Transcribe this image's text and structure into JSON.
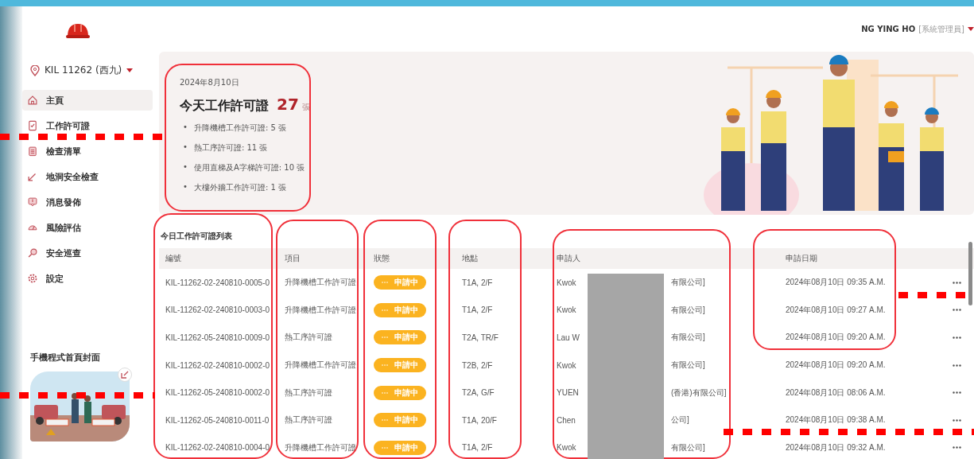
{
  "user": {
    "name": "NG YING HO",
    "role": "[系統管理員]"
  },
  "site": {
    "label": "KIL 11262 (西九)"
  },
  "sidebar": {
    "items": [
      {
        "label": "主頁",
        "selected": true
      },
      {
        "label": "工作許可證",
        "selected": false
      },
      {
        "label": "檢查清單",
        "selected": false
      },
      {
        "label": "地洞安全檢查",
        "selected": false
      },
      {
        "label": "消息發佈",
        "selected": false
      },
      {
        "label": "風險評估",
        "selected": false
      },
      {
        "label": "安全巡查",
        "selected": false
      },
      {
        "label": "設定",
        "selected": false
      }
    ],
    "cover_title": "手機程式首頁封面"
  },
  "summary": {
    "date": "2024年8月10日",
    "title": "今天工作許可證",
    "count": "27",
    "unit": "張",
    "bullet": "•",
    "items": [
      "升降機槽工作許可證: 5 張",
      "熱工序許可證: 11 張",
      "使用直梯及A字梯許可證: 10 張",
      "大樓外牆工作許可證: 1 張"
    ]
  },
  "table": {
    "title": "今日工作許可證列表",
    "columns": [
      "編號",
      "項目",
      "狀態",
      "地點",
      "申請人",
      "申請日期"
    ],
    "rows": [
      {
        "id": "KIL-11262-02-240810-0005-0",
        "item": "升降機槽工作許可證",
        "status": "申請中",
        "location": "T1A, 2/F",
        "applicant_start": "Kwok",
        "applicant_end": "有限公司]",
        "date": "2024年08月10日 09:35 A.M."
      },
      {
        "id": "KIL-11262-02-240810-0003-0",
        "item": "升降機槽工作許可證",
        "status": "申請中",
        "location": "T1A, 2/F",
        "applicant_start": "Kwok",
        "applicant_end": "有限公司]",
        "date": "2024年08月10日 09:27 A.M."
      },
      {
        "id": "KIL-11262-05-240810-0009-0",
        "item": "熱工序許可證",
        "status": "申請中",
        "location": "T2A, TR/F",
        "applicant_start": "Lau W",
        "applicant_end": "有限公司]",
        "date": "2024年08月10日 09:20 A.M."
      },
      {
        "id": "KIL-11262-02-240810-0002-0",
        "item": "升降機槽工作許可證",
        "status": "申請中",
        "location": "T2B, 2/F",
        "applicant_start": "Kwok",
        "applicant_end": "有限公司]",
        "date": "2024年08月10日 09:20 A.M."
      },
      {
        "id": "KIL-11262-05-240810-0002-0",
        "item": "熱工序許可證",
        "status": "申請中",
        "location": "T2A, G/F",
        "applicant_start": "YUEN",
        "applicant_end": "(香港)有限公司]",
        "date": "2024年08月10日 08:06 A.M."
      },
      {
        "id": "KIL-11262-05-240810-0011-0",
        "item": "熱工序許可證",
        "status": "申請中",
        "location": "T1A, 20/F",
        "applicant_start": "Chen",
        "applicant_end": "公司]",
        "date": "2024年08月10日 09:38 A.M."
      },
      {
        "id": "KIL-11262-02-240810-0004-0",
        "item": "升降機槽工作許可證",
        "status": "申請中",
        "location": "T1A, 2/F",
        "applicant_start": "Kwok",
        "applicant_end": "有限公司]",
        "date": "2024年08月10日 09:32 A.M."
      }
    ]
  }
}
